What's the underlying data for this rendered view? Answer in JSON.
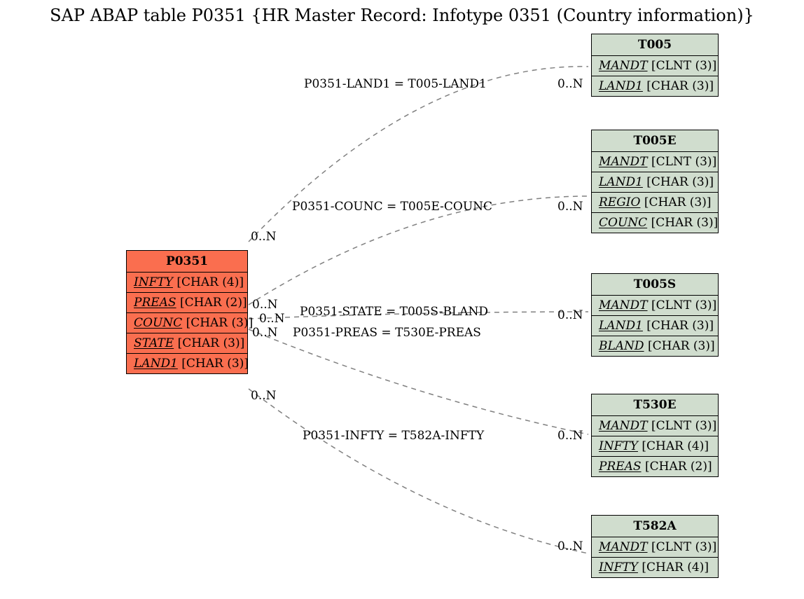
{
  "title": "SAP ABAP table P0351 {HR Master Record: Infotype 0351 (Country information)}",
  "main": {
    "name": "P0351",
    "fields": [
      {
        "name": "INFTY",
        "type": "[CHAR (4)]"
      },
      {
        "name": "PREAS",
        "type": "[CHAR (2)]"
      },
      {
        "name": "COUNC",
        "type": "[CHAR (3)]"
      },
      {
        "name": "STATE",
        "type": "[CHAR (3)]"
      },
      {
        "name": "LAND1",
        "type": "[CHAR (3)]"
      }
    ]
  },
  "refs": [
    {
      "name": "T005",
      "fields": [
        {
          "name": "MANDT",
          "type": "[CLNT (3)]"
        },
        {
          "name": "LAND1",
          "type": "[CHAR (3)]"
        }
      ]
    },
    {
      "name": "T005E",
      "fields": [
        {
          "name": "MANDT",
          "type": "[CLNT (3)]"
        },
        {
          "name": "LAND1",
          "type": "[CHAR (3)]"
        },
        {
          "name": "REGIO",
          "type": "[CHAR (3)]"
        },
        {
          "name": "COUNC",
          "type": "[CHAR (3)]"
        }
      ]
    },
    {
      "name": "T005S",
      "fields": [
        {
          "name": "MANDT",
          "type": "[CLNT (3)]"
        },
        {
          "name": "LAND1",
          "type": "[CHAR (3)]"
        },
        {
          "name": "BLAND",
          "type": "[CHAR (3)]"
        }
      ]
    },
    {
      "name": "T530E",
      "fields": [
        {
          "name": "MANDT",
          "type": "[CLNT (3)]"
        },
        {
          "name": "INFTY",
          "type": "[CHAR (4)]"
        },
        {
          "name": "PREAS",
          "type": "[CHAR (2)]"
        }
      ]
    },
    {
      "name": "T582A",
      "fields": [
        {
          "name": "MANDT",
          "type": "[CLNT (3)]"
        },
        {
          "name": "INFTY",
          "type": "[CHAR (4)]"
        }
      ]
    }
  ],
  "edges": {
    "e1": {
      "label": "P0351-LAND1 = T005-LAND1",
      "left_card": "0..N",
      "right_card": "0..N"
    },
    "e2": {
      "label": "P0351-COUNC = T005E-COUNC",
      "left_card": "0..N",
      "right_card": "0..N"
    },
    "e3": {
      "label": "P0351-STATE = T005S-BLAND",
      "left_card": "0..N",
      "right_card": "0..N"
    },
    "e4": {
      "label": "P0351-PREAS = T530E-PREAS",
      "left_card": "0..N",
      "right_card": "0..N"
    },
    "e5": {
      "label": "P0351-INFTY = T582A-INFTY",
      "left_card": "0..N",
      "right_card": "0..N"
    }
  }
}
